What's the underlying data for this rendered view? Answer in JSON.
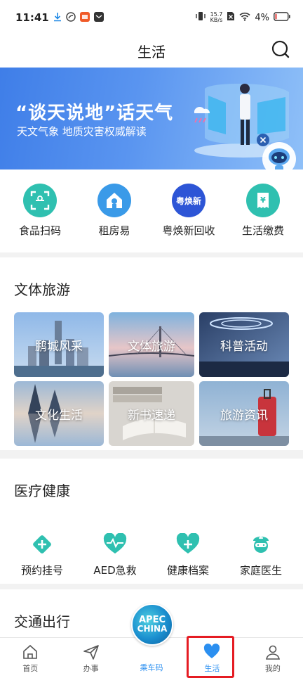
{
  "status_bar": {
    "time": "11:41",
    "net_speed_value": "15.7",
    "net_speed_unit": "KB/s",
    "battery": "4%"
  },
  "header": {
    "title": "生活"
  },
  "banner": {
    "headline": "“谈天说地”话天气",
    "subtitle": "天文气象 地质灾害权威解读"
  },
  "quick_services": [
    {
      "label": "食品扫码",
      "icon": "scan-face-icon"
    },
    {
      "label": "租房易",
      "icon": "house-icon"
    },
    {
      "label": "粤焕新回收",
      "icon": "recycle-badge-icon",
      "badge_text": "粤焕新"
    },
    {
      "label": "生活缴费",
      "icon": "yuan-receipt-icon",
      "badge_text": "¥"
    }
  ],
  "culture": {
    "title": "文体旅游",
    "tiles": [
      "鹏城风采",
      "文体旅游",
      "科普活动",
      "文化生活",
      "新书速递",
      "旅游资讯"
    ]
  },
  "medical": {
    "title": "医疗健康",
    "items": [
      {
        "label": "预约挂号",
        "icon": "plus-diamond-icon"
      },
      {
        "label": "AED急救",
        "icon": "heart-pulse-icon"
      },
      {
        "label": "健康档案",
        "icon": "heart-plus-icon"
      },
      {
        "label": "家庭医生",
        "icon": "doctor-icon"
      }
    ]
  },
  "transport": {
    "title": "交通出行"
  },
  "tab_bar": {
    "tabs": [
      {
        "label": "首页",
        "icon": "home-icon"
      },
      {
        "label": "办事",
        "icon": "send-icon"
      },
      {
        "label": "乘车码",
        "icon": "apec-badge-icon"
      },
      {
        "label": "生活",
        "icon": "heart-icon",
        "active": true
      },
      {
        "label": "我的",
        "icon": "user-icon"
      }
    ],
    "apec_line1": "APEC",
    "apec_line2": "CHINA"
  },
  "colors": {
    "accent": "#2b8ff0",
    "teal": "#2fc0b0",
    "highlight": "#e51c23"
  }
}
